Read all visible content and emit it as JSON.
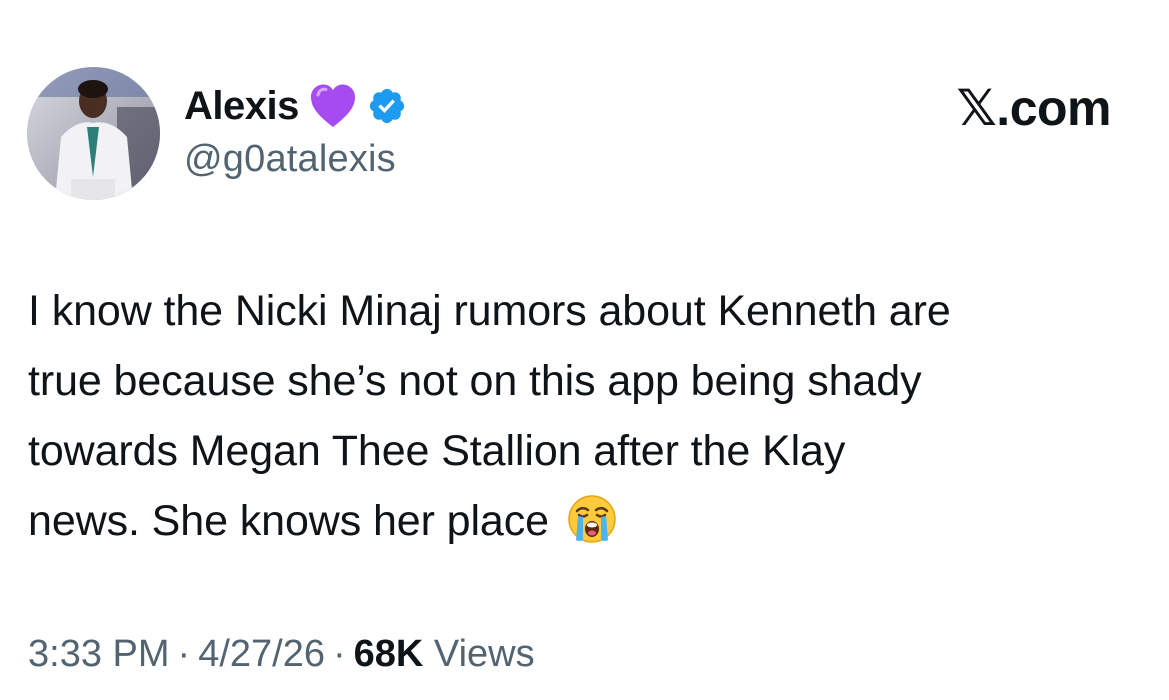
{
  "author": {
    "display_name": "Alexis",
    "handle": "@g0atalexis",
    "verified": true,
    "name_emoji": "purple-heart-icon"
  },
  "brand": {
    "label": "𝕏.com"
  },
  "tweet": {
    "lines": [
      "I know the Nicki Minaj rumors about Kenneth are",
      "true because she’s not on this app being shady",
      "towards Megan Thee Stallion after the Klay",
      "news. She knows her place"
    ],
    "trailing_emoji": "loudly-crying-face-icon"
  },
  "meta": {
    "time": "3:33 PM",
    "separator": "·",
    "date": "4/27/26",
    "views_count": "68K",
    "views_label": "Views"
  },
  "colors": {
    "text_primary": "#0f1419",
    "text_secondary": "#536471",
    "verified_blue": "#1d9bf0",
    "heart_purple": "#a54cf0"
  }
}
